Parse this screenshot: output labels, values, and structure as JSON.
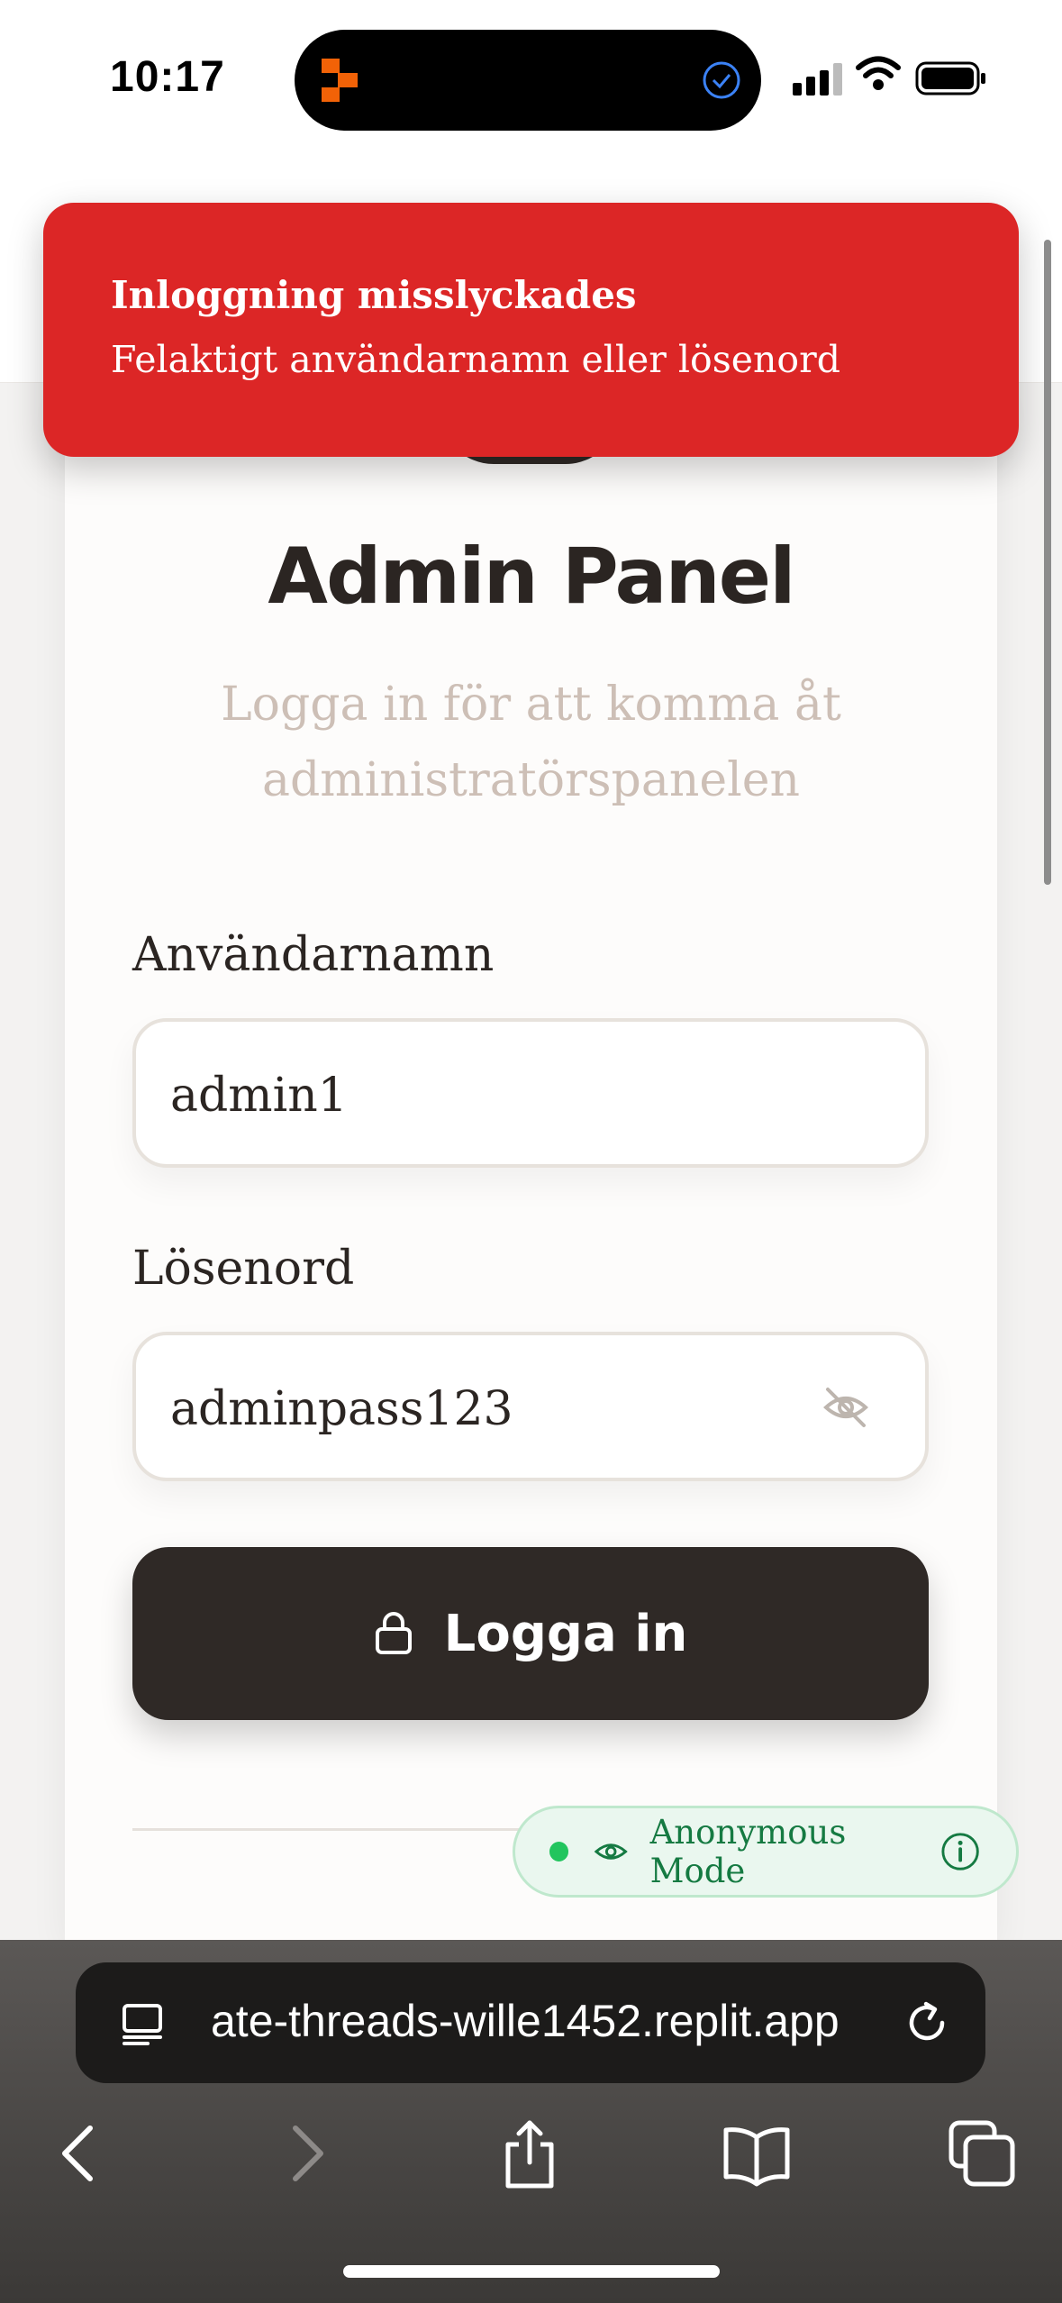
{
  "status_bar": {
    "time": "10:17"
  },
  "toast": {
    "title": "Inloggning misslyckades",
    "message": "Felaktigt användarnamn eller lösenord",
    "color": "#dc2626"
  },
  "login": {
    "title": "Admin Panel",
    "subtitle": "Logga in för att komma åt administratörspanelen",
    "username_label": "Användarnamn",
    "username_value": "admin1",
    "password_label": "Lösenord",
    "password_value": "adminpass123",
    "submit_label": "Logga in"
  },
  "anonymous_badge": {
    "label": "Anonymous Mode"
  },
  "browser": {
    "url": "ate-threads-wille1452.replit.app",
    "icons": [
      "page-menu-icon",
      "reload-icon",
      "back-icon",
      "forward-icon",
      "share-icon",
      "bookmarks-icon",
      "tabs-icon"
    ]
  },
  "colors": {
    "accent_dark": "#2f2926",
    "error": "#dc2626",
    "success": "#22c55e"
  }
}
